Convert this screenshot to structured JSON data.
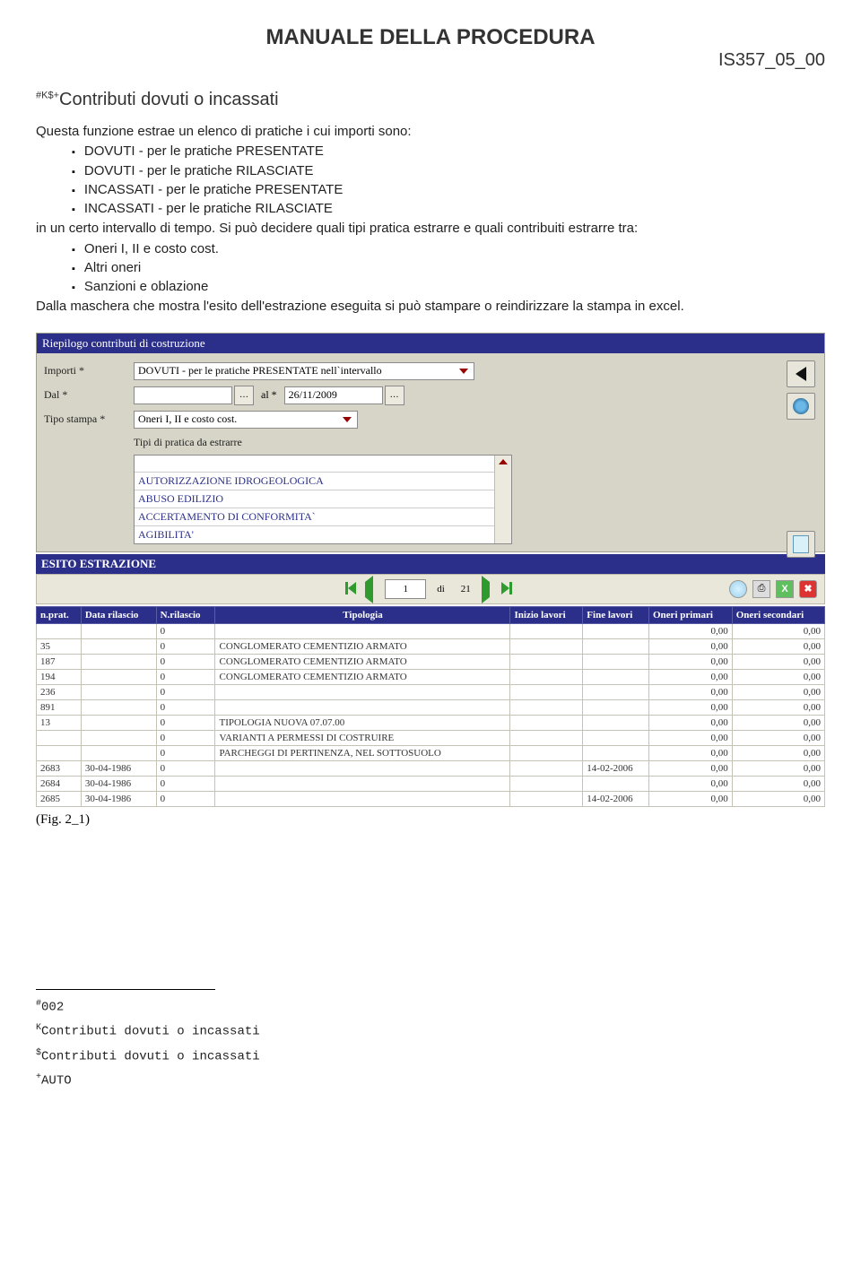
{
  "header": {
    "title": "MANUALE DELLA PROCEDURA",
    "code": "IS357_05_00",
    "sub_prefix": "#K$+",
    "sub": "Contributi dovuti o incassati"
  },
  "intro": {
    "line1": "Questa funzione estrae un elenco di pratiche i cui importi sono:",
    "bullets1": [
      "DOVUTI - per le pratiche PRESENTATE",
      "DOVUTI - per le pratiche RILASCIATE",
      "INCASSATI - per le pratiche PRESENTATE",
      "INCASSATI - per le pratiche RILASCIATE"
    ],
    "line2": "in un certo intervallo di tempo. Si può decidere quali tipi pratica estrarre e quali contribuiti estrarre tra:",
    "bullets2": [
      "Oneri I, II e costo cost.",
      "Altri oneri",
      "Sanzioni e oblazione"
    ],
    "line3": "Dalla maschera che mostra l'esito dell'estrazione eseguita si può stampare o reindirizzare la stampa in excel."
  },
  "form": {
    "panel_title": "Riepilogo contributi di costruzione",
    "label_importi": "Importi  *",
    "importi_value": "DOVUTI - per le pratiche PRESENTATE nell`intervallo",
    "label_dal": "Dal  *",
    "dal_value": "",
    "label_al": "al  *",
    "al_value": "26/11/2009",
    "label_tipo": "Tipo stampa  *",
    "tipo_value": "Oneri I, II e costo cost.",
    "tipi_label": "Tipi di pratica da estrarre",
    "tipi_items": [
      "AUTORIZZAZIONE IDROGEOLOGICA",
      "ABUSO EDILIZIO",
      "ACCERTAMENTO DI CONFORMITA`",
      "AGIBILITA'"
    ]
  },
  "esito": {
    "title": "ESITO ESTRAZIONE",
    "pager": {
      "page": "1",
      "of_label": "di",
      "total": "21"
    },
    "columns": [
      "n.prat.",
      "Data rilascio",
      "N.rilascio",
      "Tipologia",
      "Inizio lavori",
      "Fine lavori",
      "Oneri primari",
      "Oneri secondari"
    ],
    "rows": [
      {
        "nprat": "",
        "data": "",
        "nril": "0",
        "tip": "",
        "inizio": "",
        "fine": "",
        "op": "0,00",
        "os": "0,00"
      },
      {
        "nprat": "35",
        "data": "",
        "nril": "0",
        "tip": "CONGLOMERATO CEMENTIZIO ARMATO",
        "inizio": "",
        "fine": "",
        "op": "0,00",
        "os": "0,00"
      },
      {
        "nprat": "187",
        "data": "",
        "nril": "0",
        "tip": "CONGLOMERATO CEMENTIZIO ARMATO",
        "inizio": "",
        "fine": "",
        "op": "0,00",
        "os": "0,00"
      },
      {
        "nprat": "194",
        "data": "",
        "nril": "0",
        "tip": "CONGLOMERATO CEMENTIZIO ARMATO",
        "inizio": "",
        "fine": "",
        "op": "0,00",
        "os": "0,00"
      },
      {
        "nprat": "236",
        "data": "",
        "nril": "0",
        "tip": "",
        "inizio": "",
        "fine": "",
        "op": "0,00",
        "os": "0,00"
      },
      {
        "nprat": "891",
        "data": "",
        "nril": "0",
        "tip": "",
        "inizio": "",
        "fine": "",
        "op": "0,00",
        "os": "0,00"
      },
      {
        "nprat": "13",
        "data": "",
        "nril": "0",
        "tip": "TIPOLOGIA NUOVA 07.07.00",
        "inizio": "",
        "fine": "",
        "op": "0,00",
        "os": "0,00"
      },
      {
        "nprat": "",
        "data": "",
        "nril": "0",
        "tip": "VARIANTI A PERMESSI DI COSTRUIRE",
        "inizio": "",
        "fine": "",
        "op": "0,00",
        "os": "0,00"
      },
      {
        "nprat": "",
        "data": "",
        "nril": "0",
        "tip": "PARCHEGGI DI PERTINENZA, NEL SOTTOSUOLO",
        "inizio": "",
        "fine": "",
        "op": "0,00",
        "os": "0,00"
      },
      {
        "nprat": "2683",
        "data": "30-04-1986",
        "nril": "0",
        "tip": "",
        "inizio": "",
        "fine": "14-02-2006",
        "op": "0,00",
        "os": "0,00"
      },
      {
        "nprat": "2684",
        "data": "30-04-1986",
        "nril": "0",
        "tip": "",
        "inizio": "",
        "fine": "",
        "op": "0,00",
        "os": "0,00"
      },
      {
        "nprat": "2685",
        "data": "30-04-1986",
        "nril": "0",
        "tip": "",
        "inizio": "",
        "fine": "14-02-2006",
        "op": "0,00",
        "os": "0,00"
      }
    ]
  },
  "fig": "(Fig. 2_1)",
  "footnotes": {
    "f1_prefix": "#",
    "f1": "002",
    "f2_prefix": "K",
    "f2": "Contributi dovuti o incassati",
    "f3_prefix": "$",
    "f3": "Contributi dovuti o incassati",
    "f4_prefix": "+",
    "f4": "AUTO"
  }
}
